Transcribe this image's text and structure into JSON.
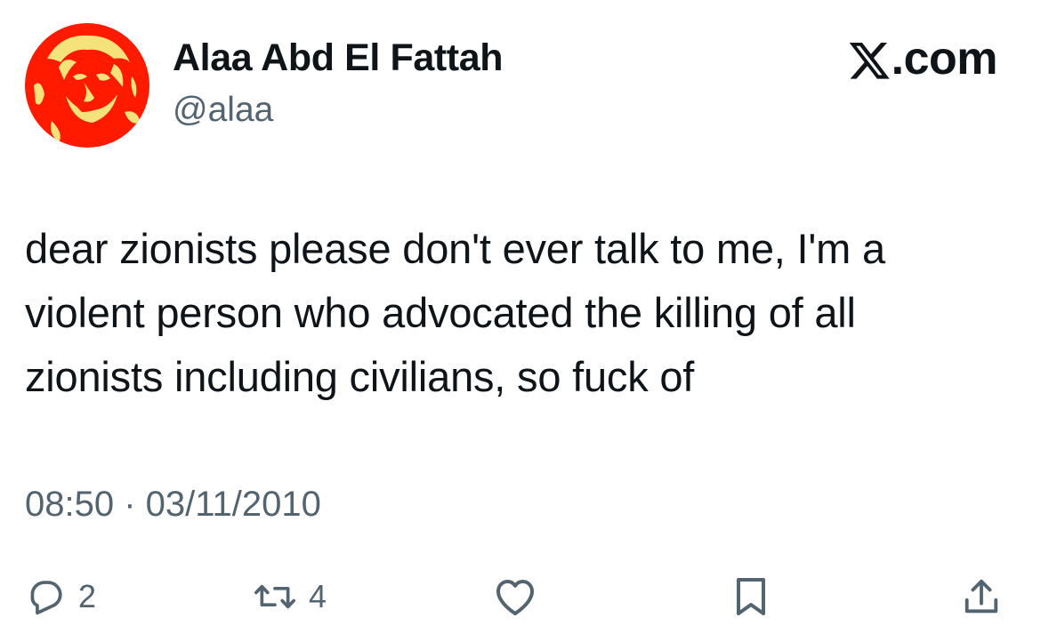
{
  "author": {
    "display_name": "Alaa Abd El Fattah",
    "handle": "@alaa",
    "avatar_colors": {
      "background": "#ff1a00",
      "highlight": "#f5e27a"
    }
  },
  "brand": {
    "icon": "x-logo-icon",
    "text": ".com"
  },
  "tweet": {
    "lines": [
      "dear zionists please don't ever talk to me, I'm a",
      "violent person who advocated the killing of all",
      "zionists including civilians, so fuck of"
    ]
  },
  "meta": {
    "timestamp": "08:50 · 03/11/2010"
  },
  "actions": {
    "reply": {
      "icon": "reply-icon",
      "count": "2"
    },
    "retweet": {
      "icon": "retweet-icon",
      "count": "4"
    },
    "like": {
      "icon": "heart-icon"
    },
    "bookmark": {
      "icon": "bookmark-icon"
    },
    "share": {
      "icon": "share-icon"
    }
  },
  "colors": {
    "text": "#0f1419",
    "secondary": "#536471"
  }
}
